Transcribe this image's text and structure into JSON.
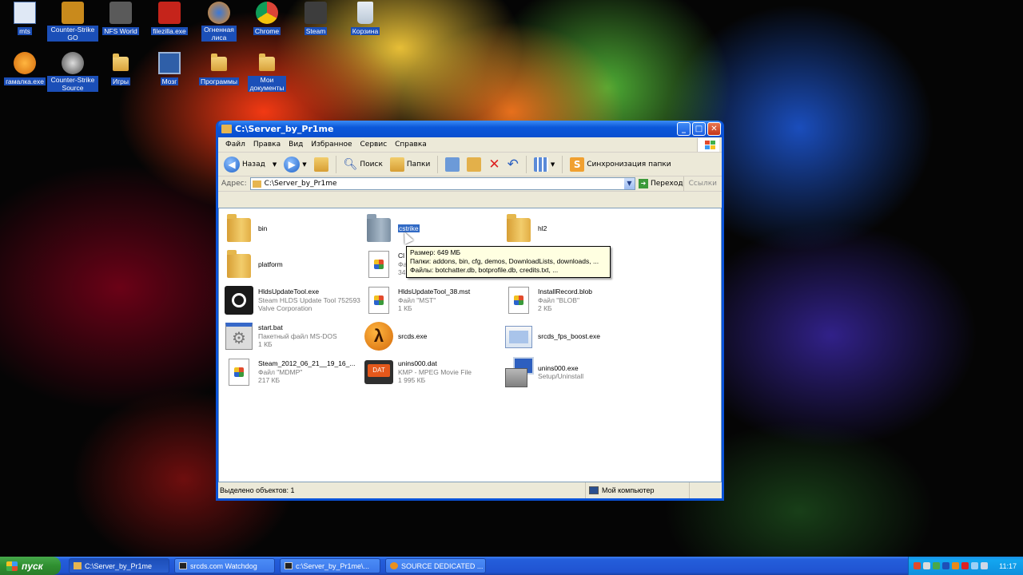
{
  "desktop": {
    "icons": [
      {
        "label": "mts"
      },
      {
        "label": "Counter-Strike GO"
      },
      {
        "label": "NFS World"
      },
      {
        "label": "filezilla.exe"
      },
      {
        "label": "Огненная лиса"
      },
      {
        "label": "Chrome"
      },
      {
        "label": "Steam"
      },
      {
        "label": "Корзина"
      },
      {
        "label": "гамалка.exe"
      },
      {
        "label": "Counter-Strike Source"
      },
      {
        "label": "Игры"
      },
      {
        "label": "Мозг"
      },
      {
        "label": "Программы"
      },
      {
        "label": "Мои документы"
      }
    ]
  },
  "window": {
    "title": "C:\\Server_by_Pr1me",
    "menu": [
      "Файл",
      "Правка",
      "Вид",
      "Избранное",
      "Сервис",
      "Справка"
    ],
    "toolbar": {
      "back": "Назад",
      "search": "Поиск",
      "folders": "Папки",
      "sync": "Синхронизация папки"
    },
    "address": {
      "label": "Адрес:",
      "value": "C:\\Server_by_Pr1me",
      "go": "Переход",
      "links": "Ссылки"
    },
    "items": [
      {
        "name": "bin",
        "sub1": "",
        "sub2": "",
        "icon": "folder-icon"
      },
      {
        "name": "cstrike",
        "sub1": "",
        "sub2": "",
        "icon": "folder-icon",
        "selected": true
      },
      {
        "name": "hl2",
        "sub1": "",
        "sub2": "",
        "icon": "folder-icon"
      },
      {
        "name": "platform",
        "sub1": "",
        "sub2": "",
        "icon": "folder-icon"
      },
      {
        "name": "Cl",
        "sub1": "Фа",
        "sub2": "34",
        "icon": "document-icon"
      },
      {
        "name": "HldsUpdateTool.exe",
        "sub1": "Steam HLDS Update Tool 752593",
        "sub2": "Valve Corporation",
        "icon": "steam-icon"
      },
      {
        "name": "HldsUpdateTool_38.mst",
        "sub1": "Файл \"MST\"",
        "sub2": "1 КБ",
        "icon": "document-icon"
      },
      {
        "name": "InstallRecord.blob",
        "sub1": "Файл \"BLOB\"",
        "sub2": "2 КБ",
        "icon": "document-icon"
      },
      {
        "name": "start.bat",
        "sub1": "Пакетный файл MS-DOS",
        "sub2": "1 КБ",
        "icon": "batch-file-icon"
      },
      {
        "name": "srcds.exe",
        "sub1": "",
        "sub2": "",
        "icon": "half-life-icon"
      },
      {
        "name": "srcds_fps_boost.exe",
        "sub1": "",
        "sub2": "",
        "icon": "application-icon"
      },
      {
        "name": "Steam_2012_06_21__19_16_...",
        "sub1": "Файл \"MDMP\"",
        "sub2": "217 КБ",
        "icon": "document-icon"
      },
      {
        "name": "unins000.dat",
        "sub1": "KMP - MPEG Movie File",
        "sub2": "1 995 КБ",
        "icon": "dat-file-icon"
      },
      {
        "name": "unins000.exe",
        "sub1": "Setup/Uninstall",
        "sub2": "",
        "icon": "setup-icon"
      }
    ],
    "tooltip": {
      "line1": "Размер: 649 МБ",
      "line2": "Папки: addons, bin, cfg, demos, DownloadLists, downloads, ...",
      "line3": "Файлы: botchatter.db, botprofile.db, credits.txt, ..."
    },
    "status": {
      "left": "Выделено объектов: 1",
      "right": "Мой компьютер"
    }
  },
  "taskbar": {
    "start": "пуск",
    "tasks": [
      {
        "label": "C:\\Server_by_Pr1me"
      },
      {
        "label": "srcds.com Watchdog"
      },
      {
        "label": "c:\\Server_by_Pr1me\\..."
      },
      {
        "label": "SOURCE DEDICATED ..."
      }
    ],
    "clock": "11:17"
  },
  "colors": {
    "selection": "#316ac5",
    "taskbar": "#245edb",
    "start": "#2f8f30",
    "tooltip_bg": "#ffffe1"
  }
}
